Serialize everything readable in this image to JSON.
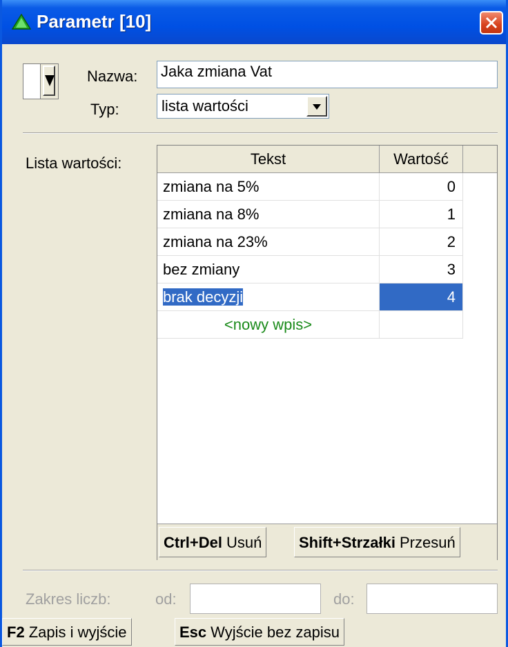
{
  "window": {
    "title": "Parametr [10]"
  },
  "form": {
    "name_label": "Nazwa:",
    "name_value": "Jaka zmiana Vat",
    "type_label": "Typ:",
    "type_value": "lista wartości",
    "list_label": "Lista wartości:"
  },
  "grid": {
    "columns": [
      "Tekst",
      "Wartość"
    ],
    "rows": [
      {
        "text": "zmiana na 5%",
        "value": "0"
      },
      {
        "text": "zmiana na 8%",
        "value": "1"
      },
      {
        "text": "zmiana na 23%",
        "value": "2"
      },
      {
        "text": "bez zmiany",
        "value": "3"
      },
      {
        "text": "brak decyzji",
        "value": "4"
      }
    ],
    "new_entry": "<nowy wpis>",
    "hotkeys": [
      {
        "key": "Ctrl+Del",
        "label": "Usuń"
      },
      {
        "key": "Shift+Strzałki",
        "label": "Przesuń"
      }
    ]
  },
  "range": {
    "label": "Zakres liczb:",
    "from_label": "od:",
    "to_label": "do:",
    "from_value": "",
    "to_value": ""
  },
  "footer": [
    {
      "key": "F2",
      "label": "Zapis i wyjście"
    },
    {
      "key": "Esc",
      "label": "Wyjście bez zapisu"
    }
  ]
}
